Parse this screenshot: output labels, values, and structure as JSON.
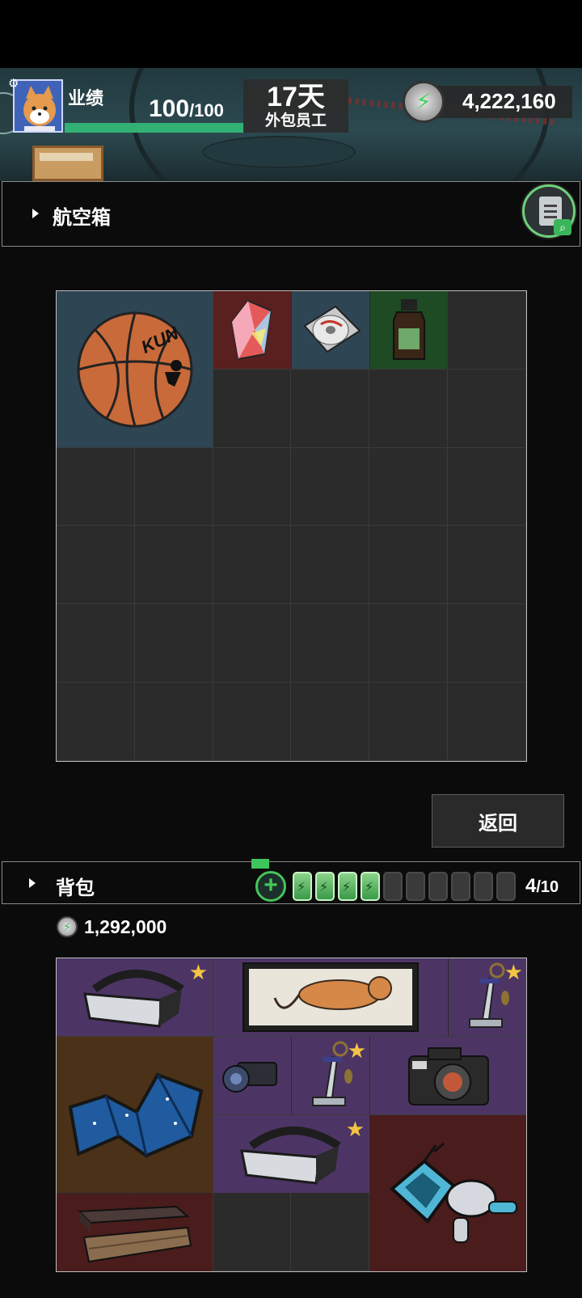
{
  "header": {
    "performance_label": "业绩",
    "performance_value": "100",
    "performance_max": "/100",
    "performance_fraction": 1.0,
    "days": "17天",
    "role": "外包员工",
    "currency": "4,222,160"
  },
  "flight_case": {
    "title": "航空箱",
    "search_icon": "clipboard-search-icon",
    "items": [
      {
        "name": "basketball",
        "label": "KUN",
        "rarity_color": "#2e4554"
      },
      {
        "name": "crystal",
        "rarity_color": "#5a1f1f"
      },
      {
        "name": "cd-disc",
        "rarity_color": "#2e4554"
      },
      {
        "name": "medicine-bottle",
        "rarity_color": "#1e4a24"
      }
    ]
  },
  "return_button": "返回",
  "backpack": {
    "title": "背包",
    "battery_count": "4",
    "battery_max": "/10",
    "batteries_full": 4,
    "batteries_total": 10,
    "currency": "1,292,000",
    "items": [
      {
        "name": "vr-headset",
        "starred": true,
        "rarity_color": "#4c3564"
      },
      {
        "name": "tiger-painting",
        "starred": false,
        "rarity_color": "#4c3564"
      },
      {
        "name": "sword-keychain",
        "starred": true,
        "rarity_color": "#4c3564"
      },
      {
        "name": "star-map",
        "starred": false,
        "rarity_color": "#4a3118"
      },
      {
        "name": "scope",
        "starred": false,
        "rarity_color": "#4c3564"
      },
      {
        "name": "sword-keychain",
        "starred": true,
        "rarity_color": "#4c3564"
      },
      {
        "name": "camera",
        "starred": false,
        "rarity_color": "#4c3564"
      },
      {
        "name": "vr-headset",
        "starred": true,
        "rarity_color": "#4c3564"
      },
      {
        "name": "robot-figure",
        "starred": false,
        "rarity_color": "#4a1c1c"
      },
      {
        "name": "wooden-box",
        "starred": false,
        "rarity_color": "#4a1c1c"
      }
    ]
  },
  "colors": {
    "accent_green": "#33b074",
    "gold_star": "#f4c542",
    "purple_rarity": "#4c3564",
    "red_rarity": "#4a1c1c",
    "brown_rarity": "#4a3118"
  }
}
